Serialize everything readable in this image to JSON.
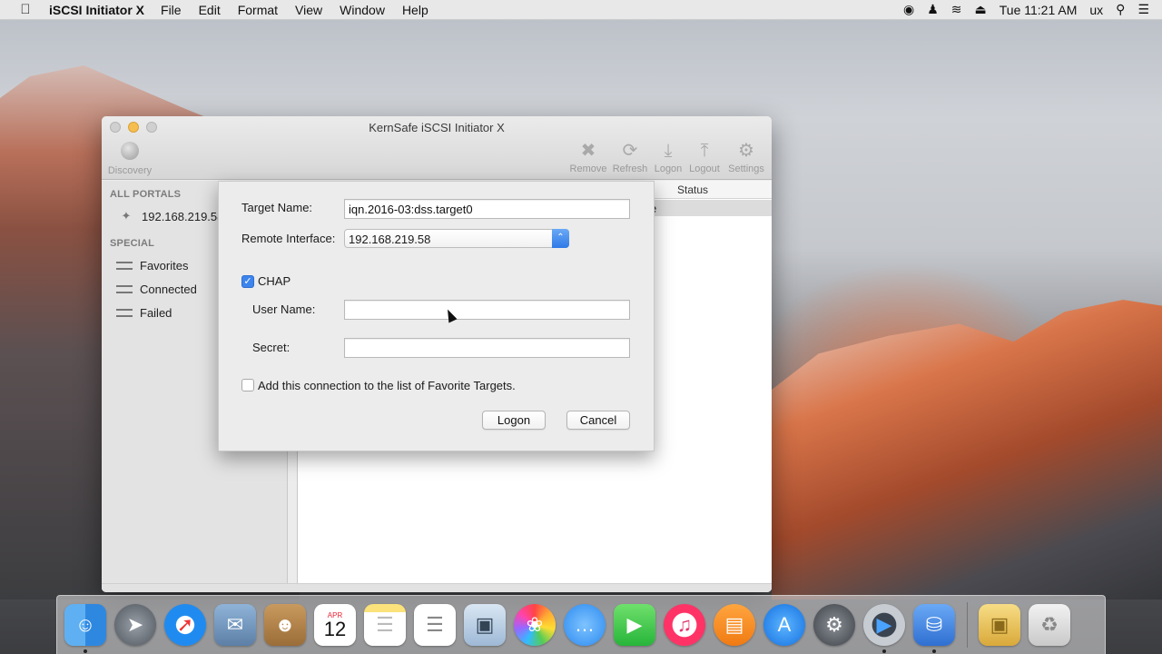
{
  "menubar": {
    "app_name": "iSCSI Initiator X",
    "items": [
      "File",
      "Edit",
      "Format",
      "View",
      "Window",
      "Help"
    ],
    "clock": "Tue 11:21 AM",
    "user": "ux"
  },
  "window": {
    "title": "KernSafe iSCSI Initiator X",
    "toolbar": {
      "discovery": "Discovery",
      "remove": "Remove",
      "refresh": "Refresh",
      "logon": "Logon",
      "logout": "Logout",
      "settings": "Settings"
    },
    "sidebar": {
      "all_portals_header": "ALL PORTALS",
      "portal_item": "192.168.219.58",
      "special_header": "SPECIAL",
      "items": [
        "Favorites",
        "Connected",
        "Failed"
      ]
    },
    "list": {
      "status_header": "Status",
      "row_status_partial": "e"
    }
  },
  "sheet": {
    "target_name_label": "Target Name:",
    "target_name_value": "iqn.2016-03:dss.target0",
    "remote_interface_label": "Remote Interface:",
    "remote_interface_value": "192.168.219.58",
    "chap_label": "CHAP",
    "chap_checked": true,
    "user_name_label": "User Name:",
    "user_name_value": "",
    "secret_label": "Secret:",
    "secret_value": "",
    "favorite_label": "Add this connection to the list of Favorite Targets.",
    "favorite_checked": false,
    "logon_button": "Logon",
    "cancel_button": "Cancel"
  },
  "dock": {
    "calendar_month": "APR",
    "calendar_day": "12",
    "apps": [
      "finder",
      "launchpad",
      "safari",
      "mail",
      "contacts",
      "calendar",
      "notes",
      "reminders",
      "preview",
      "photos",
      "messages",
      "facetime",
      "itunes",
      "ibooks",
      "app-store",
      "system-preferences",
      "quicktime",
      "iscsi-initiator",
      "package",
      "trash"
    ]
  },
  "colors": {
    "accent": "#3d85ec",
    "window_bg": "#ececec"
  }
}
